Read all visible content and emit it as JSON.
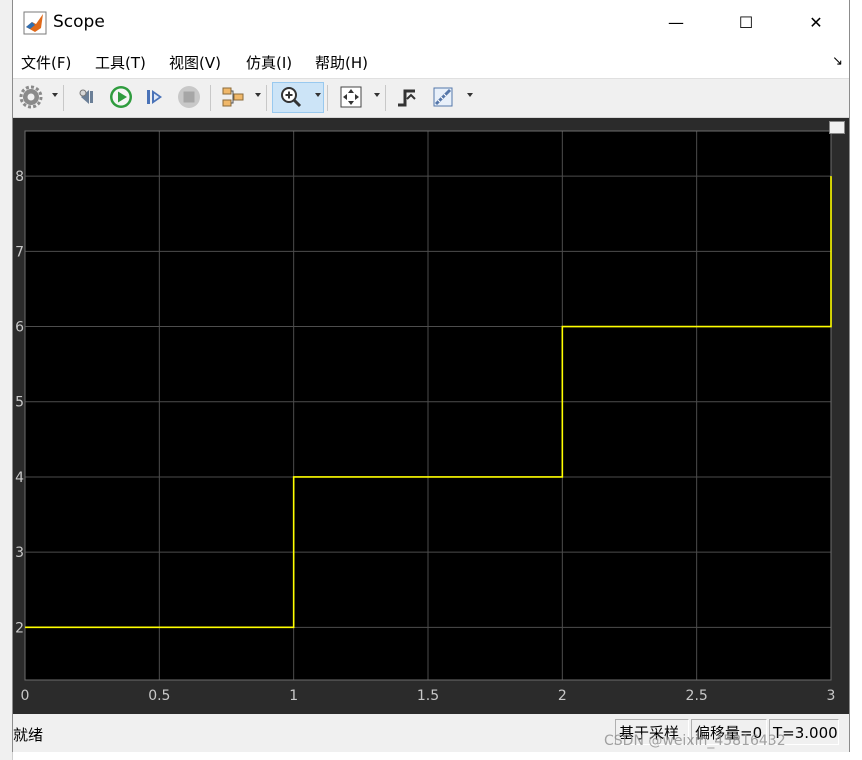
{
  "window": {
    "title": "Scope"
  },
  "window_buttons": {
    "minimize": "—",
    "maximize": "☐",
    "close": "✕"
  },
  "menu": {
    "file": "文件(F)",
    "tools": "工具(T)",
    "view": "视图(V)",
    "simulation": "仿真(I)",
    "help": "帮助(H)",
    "overflow": "↘"
  },
  "toolbar": {
    "icons": [
      "gear-icon",
      "step-back-icon",
      "run-icon",
      "step-forward-icon",
      "stop-icon",
      "signal-select-icon",
      "zoom-in-icon",
      "fit-axes-icon",
      "triggers-icon",
      "measurements-icon"
    ]
  },
  "chart_data": {
    "type": "line",
    "step": true,
    "xlim": [
      0,
      3
    ],
    "ylim": [
      1.3,
      8.6
    ],
    "xticks": [
      "0",
      "0.5",
      "1",
      "1.5",
      "2",
      "2.5",
      "3"
    ],
    "yticks": [
      "2",
      "3",
      "4",
      "5",
      "6",
      "7",
      "8"
    ],
    "grid": true,
    "line_color": "#ffff00",
    "background": "#000000",
    "series": [
      {
        "x": [
          0,
          1,
          1,
          2,
          2,
          3,
          3
        ],
        "y": [
          2,
          2,
          4,
          4,
          6,
          6,
          8
        ]
      }
    ]
  },
  "status": {
    "text": "就绪",
    "sample_mode": "基于采样",
    "offset": "偏移量=0",
    "time": "T=3.000"
  },
  "watermark": "CSDN @weixin_45816432"
}
